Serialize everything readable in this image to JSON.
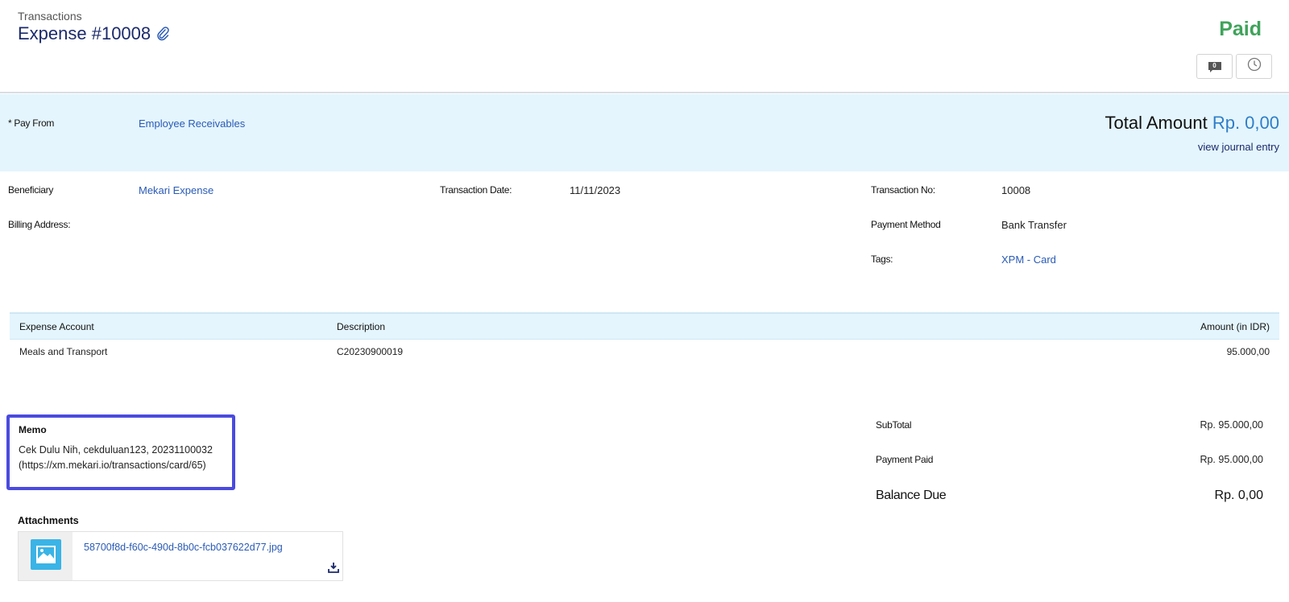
{
  "header": {
    "breadcrumb": "Transactions",
    "title": "Expense #10008",
    "status": "Paid",
    "comment_count": "0",
    "status_color": "#3fa35a"
  },
  "pay_from": {
    "label": "* Pay From",
    "value": "Employee Receivables",
    "total_label": "Total Amount",
    "total_value": "Rp. 0,00",
    "journal_link": "view journal entry"
  },
  "details": {
    "beneficiary_label": "Beneficiary",
    "beneficiary_value": "Mekari Expense",
    "billing_label": "Billing Address:",
    "date_label": "Transaction Date:",
    "date_value": "11/11/2023",
    "txno_label": "Transaction No:",
    "txno_value": "10008",
    "method_label": "Payment Method",
    "method_value": "Bank Transfer",
    "tags_label": "Tags:",
    "tags_value": "XPM - Card"
  },
  "table": {
    "headers": [
      "Expense Account",
      "Description",
      "Amount (in IDR)"
    ],
    "rows": [
      {
        "account": "Meals and Transport",
        "description": "C20230900019",
        "amount": "95.000,00"
      }
    ]
  },
  "memo": {
    "title": "Memo",
    "line1": "Cek Dulu Nih, cekduluan123, 20231100032",
    "line2": "(https://xm.mekari.io/transactions/card/65)"
  },
  "attachments": {
    "title": "Attachments",
    "files": [
      {
        "name": "58700f8d-f60c-490d-8b0c-fcb037622d77.jpg"
      }
    ]
  },
  "summary": {
    "subtotal_label": "SubTotal",
    "subtotal_value": "Rp. 95.000,00",
    "paid_label": "Payment Paid",
    "paid_value": "Rp. 95.000,00",
    "balance_label": "Balance Due",
    "balance_value": "Rp. 0,00"
  },
  "colors": {
    "accent": "#2a5bb5",
    "band": "#e4f5fd",
    "memo_highlight": "#4a4adf"
  },
  "icons": [
    "paperclip-icon",
    "comment-icon",
    "clock-icon",
    "image-icon",
    "download-icon"
  ]
}
